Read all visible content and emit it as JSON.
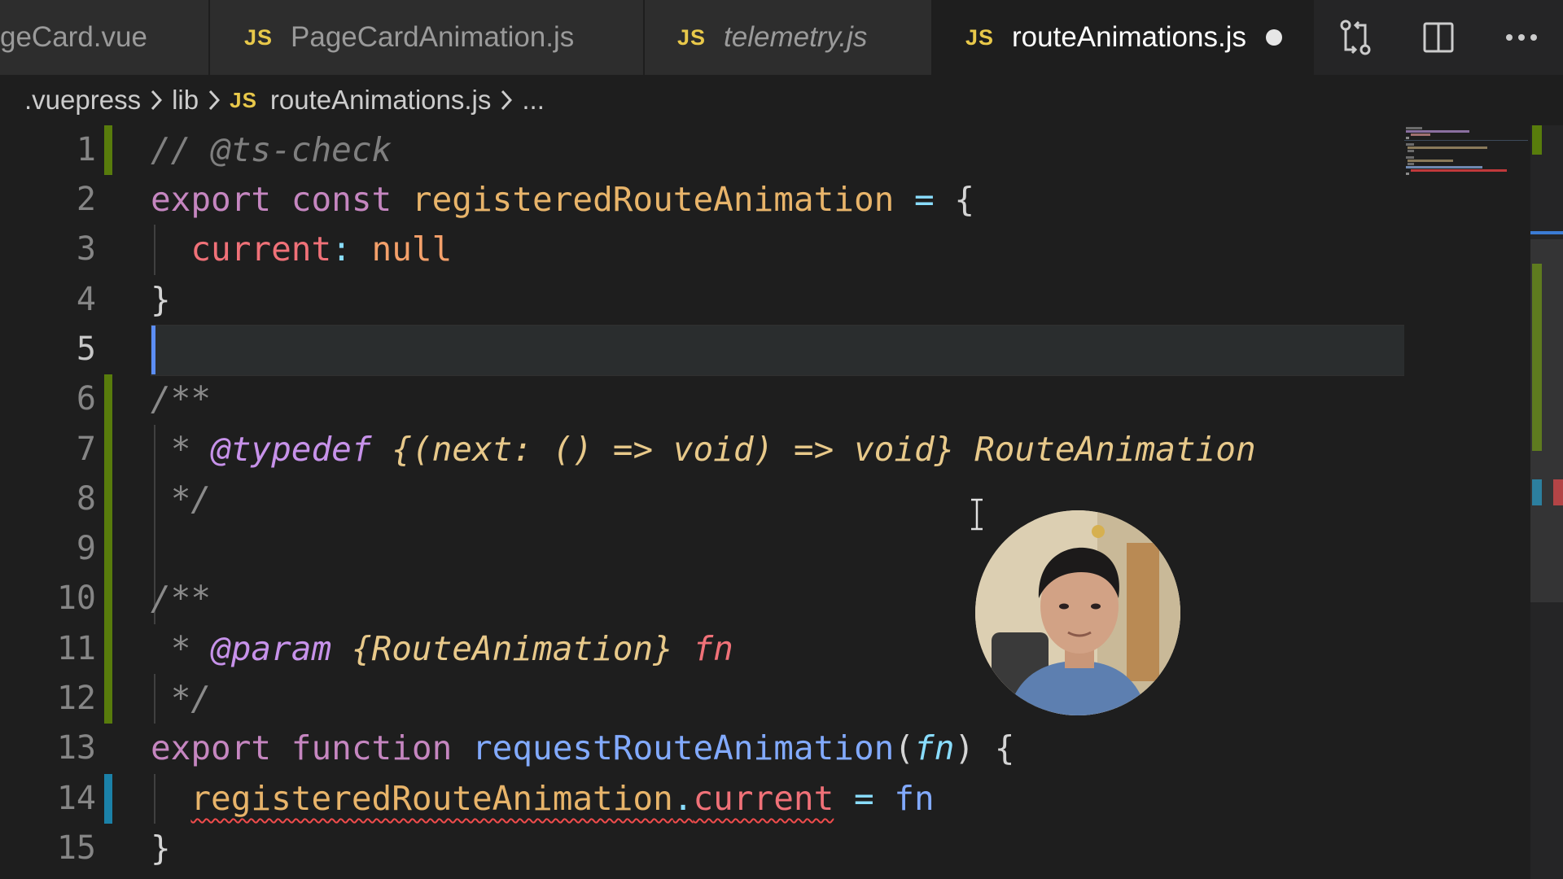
{
  "tabs": [
    {
      "label": "geCard.vue",
      "icon": "",
      "active": false,
      "italic": false
    },
    {
      "label": "PageCardAnimation.js",
      "icon": "JS",
      "active": false,
      "italic": false
    },
    {
      "label": "telemetry.js",
      "icon": "JS",
      "active": false,
      "italic": true
    },
    {
      "label": "routeAnimations.js",
      "icon": "JS",
      "active": true,
      "italic": false,
      "dirty": true
    }
  ],
  "tab_actions": [
    "source-control-compare-icon",
    "split-editor-icon",
    "more-actions-icon"
  ],
  "breadcrumb": {
    "items": [
      ".vuepress",
      "lib",
      "routeAnimations.js",
      "..."
    ],
    "file_icon": "JS"
  },
  "editor": {
    "line_numbers": [
      "1",
      "2",
      "3",
      "4",
      "5",
      "6",
      "7",
      "8",
      "9",
      "10",
      "11",
      "12",
      "13",
      "14",
      "15"
    ],
    "current_line": "5",
    "lines": {
      "l1": "// @ts-check",
      "l2": {
        "kw1": "export",
        "kw2": "const",
        "name": "registeredRouteAnimation",
        "op": "=",
        "brace": "{"
      },
      "l3": {
        "prop": "current",
        "colon": ":",
        "val": "null"
      },
      "l4": "}",
      "l6": "/**",
      "l7": {
        "star": "*",
        "tag": "@typedef",
        "type": "{(next: () => void) => void}",
        "name": "RouteAnimation"
      },
      "l8": "*/",
      "l10": "/**",
      "l11": {
        "star": "*",
        "tag": "@param",
        "type": "{RouteAnimation}",
        "name": "fn"
      },
      "l12": "*/",
      "l13": {
        "kw1": "export",
        "kw2": "function",
        "fname": "requestRouteAnimation",
        "open": "(",
        "param": "fn",
        "close": ")",
        "brace": "{"
      },
      "l14": {
        "obj": "registeredRouteAnimation",
        "dot": ".",
        "prop": "current",
        "op": "=",
        "val": "fn"
      },
      "l15": "}"
    }
  },
  "colors": {
    "keyword": "#c586c0",
    "variable": "#e8b46a",
    "property": "#f07178",
    "function": "#82aaff",
    "operator": "#89ddff",
    "git_added": "#587c0c",
    "git_modified": "#1b81a8",
    "error": "#f14c4c"
  }
}
